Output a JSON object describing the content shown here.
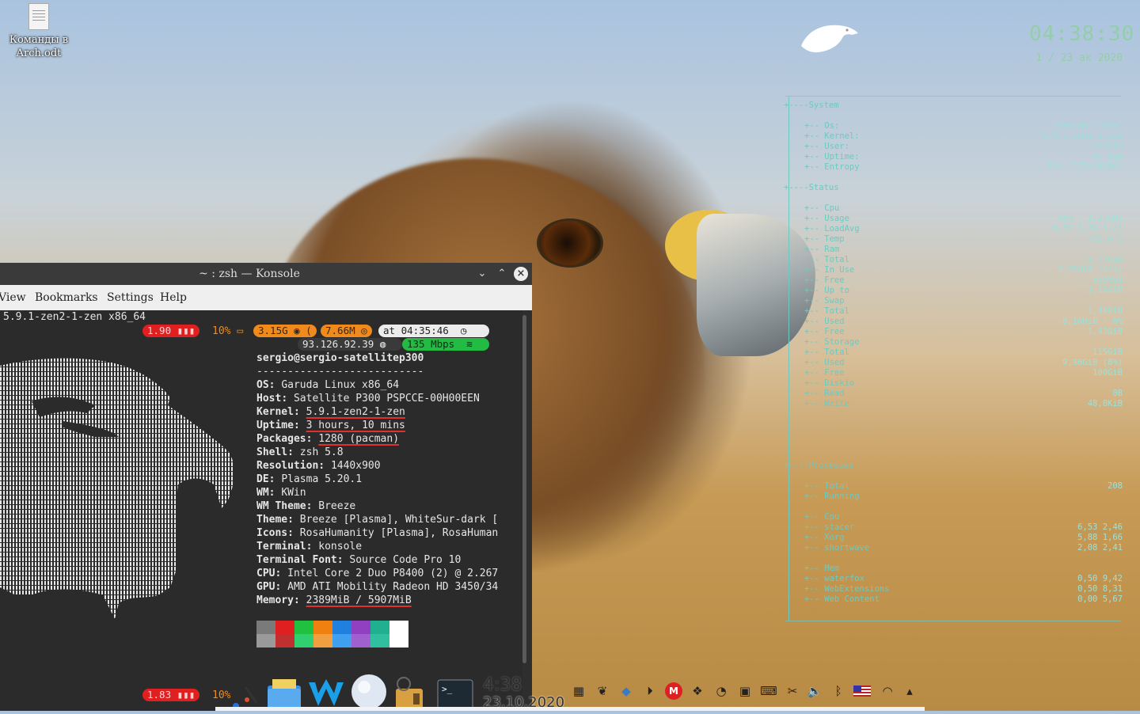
{
  "desktop": {
    "icon_label": "Команды в Arch.odt"
  },
  "conky": {
    "time": "04:38:30",
    "date": "1 / 23 ak 2020",
    "sections": {
      "system": "System",
      "status": "Status",
      "processes": "Processes"
    },
    "system_rows": [
      {
        "k": "+-- Os:",
        "v": "\"Garuda Linux\""
      },
      {
        "k": "+-- Kernel:",
        "v": "5.9.1-zen2-1-zen"
      },
      {
        "k": "+-- User:",
        "v": "sergio"
      },
      {
        "k": "+-- Uptime:",
        "v": "3h 12m"
      },
      {
        "k": "+-- Entropy",
        "v": "92% (3754/4096)"
      }
    ],
    "status_rows": [
      {
        "k": "+-- Cpu",
        "v": ""
      },
      {
        "k": "    +-- Usage",
        "v": "28% - 2,27GHz"
      },
      {
        "k": "    +-- LoadAvg",
        "v": "0,78 1,39 1,41"
      },
      {
        "k": "    +-- Temp",
        "v": "+80.0°C"
      },
      {
        "k": "+-- Ram",
        "v": ""
      },
      {
        "k": "    +-- Total",
        "v": "5,77GiB"
      },
      {
        "k": "    +-- In Use",
        "v": "2,58GiB (44%)"
      },
      {
        "k": "    +-- Free",
        "v": "638MiB"
      },
      {
        "k": "    +-- Up to",
        "v": "3,19GiB"
      },
      {
        "k": "+-- Swap",
        "v": ""
      },
      {
        "k": "    +-- Total",
        "v": "1,44GiB"
      },
      {
        "k": "    +-- Used",
        "v": "8,16MiB - 0%"
      },
      {
        "k": "    +-- Free",
        "v": "1,43GiB"
      },
      {
        "k": "+-- Storage",
        "v": ""
      },
      {
        "k": "    +-- Total",
        "v": "115GiB"
      },
      {
        "k": "    +-- Used",
        "v": "9,96GiB (8%)"
      },
      {
        "k": "    +-- Free",
        "v": "100GiB"
      },
      {
        "k": "+-- Diskio",
        "v": ""
      },
      {
        "k": "    +-- Read",
        "v": "0B"
      },
      {
        "k": "    +-- Write",
        "v": "48,0KiB"
      }
    ],
    "process_rows": [
      {
        "k": "+-- Total",
        "v": "208"
      },
      {
        "k": "+-- Running",
        "v": ""
      },
      {
        "k": "",
        "v": ""
      },
      {
        "k": "+-- Cpu",
        "v": ""
      },
      {
        "k": "    +-- stacer",
        "v": "6,53  2,46"
      },
      {
        "k": "    +-- Xorg",
        "v": "5,88  1,66"
      },
      {
        "k": "    +-- shortwave",
        "v": "2,08  2,41"
      },
      {
        "k": "",
        "v": ""
      },
      {
        "k": "+-- Mem",
        "v": ""
      },
      {
        "k": "    +-- waterfox",
        "v": "0,50  9,42"
      },
      {
        "k": "    +-- WebExtensions",
        "v": "0,50  8,31"
      },
      {
        "k": "    +-- Web Content",
        "v": "0,00  5,67"
      }
    ]
  },
  "konsole": {
    "title": "~ : zsh — Konsole",
    "menu": [
      "View",
      "Bookmarks",
      "Settings",
      "Help"
    ],
    "header_line": "5.9.1-zen2-1-zen x86_64",
    "prompt_top": {
      "load": "1.90",
      "cpu": "10%",
      "mem": "3.15G",
      "swap": "7.66M",
      "time": "at 04:35:46",
      "ip": "93.126.92.39",
      "net": "135 Mbps"
    },
    "neofetch": {
      "userhost": "sergio@sergio-satellitep300",
      "separator": "---------------------------",
      "fields": [
        {
          "k": "OS",
          "v": "Garuda Linux x86_64"
        },
        {
          "k": "Host",
          "v": "Satellite P300 PSPCCE-00H00EEN"
        },
        {
          "k": "Kernel",
          "v": "5.9.1-zen2-1-zen"
        },
        {
          "k": "Uptime",
          "v": "3 hours, 10 mins"
        },
        {
          "k": "Packages",
          "v": "1280 (pacman)"
        },
        {
          "k": "Shell",
          "v": "zsh 5.8"
        },
        {
          "k": "Resolution",
          "v": "1440x900"
        },
        {
          "k": "DE",
          "v": "Plasma 5.20.1"
        },
        {
          "k": "WM",
          "v": "KWin"
        },
        {
          "k": "WM Theme",
          "v": "Breeze"
        },
        {
          "k": "Theme",
          "v": "Breeze [Plasma], WhiteSur-dark ["
        },
        {
          "k": "Icons",
          "v": "RosaHumanity [Plasma], RosaHuman"
        },
        {
          "k": "Terminal",
          "v": "konsole"
        },
        {
          "k": "Terminal Font",
          "v": "Source Code Pro 10"
        },
        {
          "k": "CPU",
          "v": "Intel Core 2 Duo P8400 (2) @ 2.267"
        },
        {
          "k": "GPU",
          "v": "AMD ATI Mobility Radeon HD 3450/34"
        },
        {
          "k": "Memory",
          "v": "2389MiB / 5907MiB"
        }
      ],
      "palette_top": [
        "#7a7a7a",
        "#e02020",
        "#20c040",
        "#f08010",
        "#2080e0",
        "#9040c0",
        "#20b090",
        "#ffffff"
      ],
      "palette_bottom": [
        "#9a9a9a",
        "#c03030",
        "#30d070",
        "#f0a040",
        "#40a0f0",
        "#a060d0",
        "#30c0a0",
        "#ffffff"
      ]
    },
    "prompt_bottom": {
      "load": "1.83",
      "cpu": "10%"
    }
  },
  "taskbar": {
    "clock_time": "4:38",
    "clock_date": "23.10.2020"
  }
}
